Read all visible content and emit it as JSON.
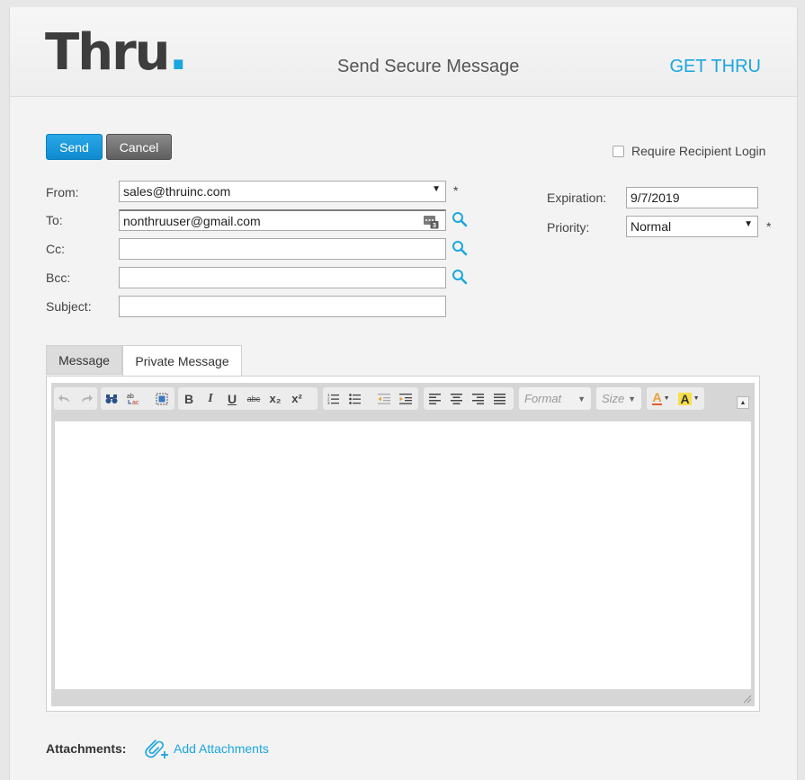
{
  "header": {
    "logo_text": "Thru",
    "logo_dot": ".",
    "title": "Send Secure Message",
    "get_thru_label": "GET THRU"
  },
  "actions": {
    "send_label": "Send",
    "cancel_label": "Cancel"
  },
  "options": {
    "require_login_label": "Require Recipient Login",
    "require_login_checked": false
  },
  "form": {
    "from_label": "From:",
    "from_value": "sales@thruinc.com",
    "to_label": "To:",
    "to_value": "nonthruuser@gmail.com",
    "to_badge_count": "3",
    "cc_label": "Cc:",
    "cc_value": "",
    "bcc_label": "Bcc:",
    "bcc_value": "",
    "subject_label": "Subject:",
    "subject_value": "",
    "required_marker": "*",
    "expiration_label": "Expiration:",
    "expiration_value": "9/7/2019",
    "priority_label": "Priority:",
    "priority_value": "Normal"
  },
  "tabs": [
    {
      "label": "Message",
      "active": true
    },
    {
      "label": "Private Message",
      "active": false
    }
  ],
  "editor": {
    "format_placeholder": "Format",
    "size_placeholder": "Size",
    "bold_glyph": "B",
    "italic_glyph": "I",
    "underline_glyph": "U",
    "strike_glyph": "abc",
    "subscript_glyph": "x₂",
    "superscript_glyph": "x²",
    "text_color_glyph": "A",
    "bg_color_glyph": "A",
    "content": ""
  },
  "attachments": {
    "label": "Attachments:",
    "add_label": "Add Attachments"
  },
  "colors": {
    "accent": "#1aa6de",
    "send_button": "#1e98dc",
    "cancel_button": "#6f6f6f"
  }
}
